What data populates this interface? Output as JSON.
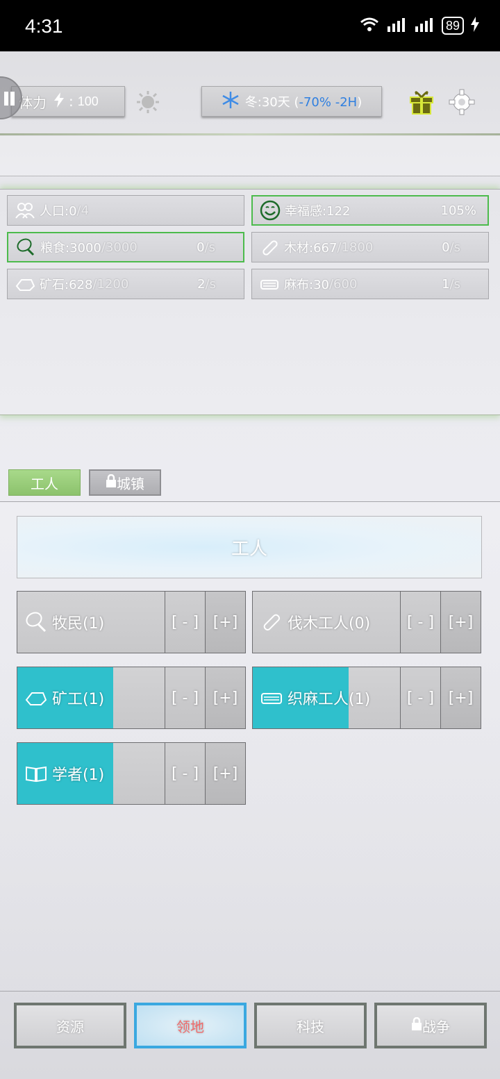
{
  "status_bar": {
    "time": "4:31",
    "battery": "89"
  },
  "hud": {
    "stamina_label": "体力",
    "stamina_sep": ":",
    "stamina_value": "100",
    "season_text": "冬:30天 (",
    "season_mod": "-70% -2H",
    "season_close": ")"
  },
  "resources": [
    {
      "icon": "people-icon",
      "name": "人口:0",
      "max": "/4",
      "rate": "",
      "unit": "",
      "extra": ""
    },
    {
      "icon": "smile-icon",
      "name": "幸福感:122",
      "max": "",
      "rate": "",
      "unit": "",
      "extra": "105%"
    },
    {
      "icon": "meat-icon",
      "name": "粮食:3000",
      "max": "/3000",
      "rate": "0",
      "unit": "/s",
      "extra": ""
    },
    {
      "icon": "wood-icon",
      "name": "木材:667",
      "max": "/1800",
      "rate": "0",
      "unit": "/s",
      "extra": ""
    },
    {
      "icon": "ore-icon",
      "name": "矿石:628",
      "max": "/1200",
      "rate": "2",
      "unit": "/s",
      "extra": ""
    },
    {
      "icon": "cloth-icon",
      "name": "麻布:30",
      "max": "/600",
      "rate": "1",
      "unit": "/s",
      "extra": ""
    }
  ],
  "tabs": {
    "workers": "工人",
    "town": "城镇"
  },
  "workers_banner": "工人",
  "jobs": [
    {
      "label": "牧民(1)",
      "progress": 0,
      "minus": "[ - ]",
      "plus": "[+]"
    },
    {
      "label": "伐木工人(0)",
      "progress": 0,
      "minus": "[ - ]",
      "plus": "[+]"
    },
    {
      "label": "矿工(1)",
      "progress": 0.42,
      "minus": "[ - ]",
      "plus": "[+]"
    },
    {
      "label": "织麻工人(1)",
      "progress": 0.42,
      "minus": "[ - ]",
      "plus": "[+]"
    },
    {
      "label": "学者(1)",
      "progress": 0.42,
      "minus": "[ - ]",
      "plus": "[+]"
    }
  ],
  "nav": {
    "resources": "资源",
    "territory": "领地",
    "tech": "科技",
    "war": "战争"
  },
  "colors": {
    "accent_cyan": "#2fc0cc",
    "season_mod": "#2f7fe0",
    "active_nav": "#3aa8e0",
    "active_nav_text": "#f06a6a",
    "green_border": "#4cbb4c"
  }
}
